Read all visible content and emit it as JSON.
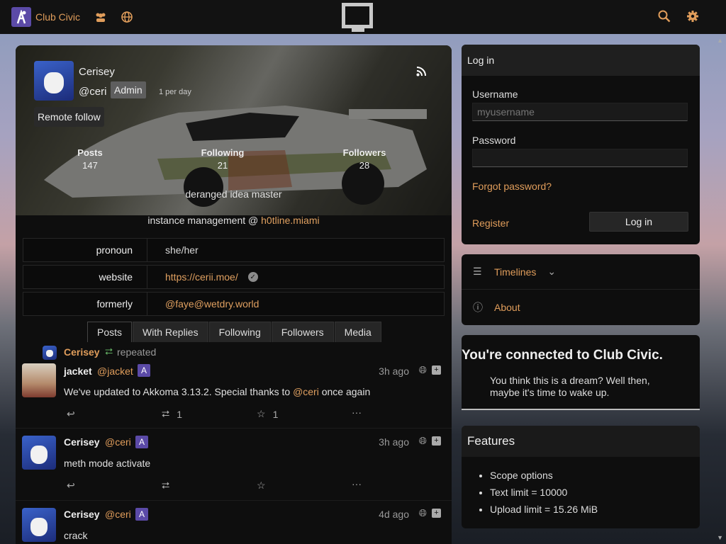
{
  "topbar": {
    "site_name": "Club Civic"
  },
  "profile": {
    "display_name": "Cerisey",
    "handle": "@ceri",
    "badge": "Admin",
    "rate": "1 per day",
    "remote_follow": "Remote follow",
    "stats": [
      {
        "label": "Posts",
        "value": "147"
      },
      {
        "label": "Following",
        "value": "21"
      },
      {
        "label": "Followers",
        "value": "28"
      }
    ],
    "bio_line1": "deranged idea master",
    "bio_line2_prefix": "instance management @ ",
    "bio_line2_link": "h0tline.miami",
    "fields": [
      {
        "name": "pronoun",
        "value": "she/her"
      },
      {
        "name": "website",
        "value": "https://cerii.moe/"
      },
      {
        "name": "formerly",
        "value": "@faye@wetdry.world"
      }
    ],
    "tabs": [
      "Posts",
      "With Replies",
      "Following",
      "Followers",
      "Media"
    ]
  },
  "posts": [
    {
      "repeat_by": "Cerisey",
      "repeat_text": "repeated",
      "name": "jacket",
      "handle": "@jacket",
      "time": "3h ago",
      "text_prefix": "We've updated to Akkoma 3.13.2. Special thanks to ",
      "text_mention": "@ceri",
      "text_suffix": " once again",
      "repeats": "1",
      "favs": "1"
    },
    {
      "name": "Cerisey",
      "handle": "@ceri",
      "time": "3h ago",
      "text": "meth mode activate"
    },
    {
      "name": "Cerisey",
      "handle": "@ceri",
      "time": "4d ago",
      "text": "crack"
    }
  ],
  "login": {
    "title": "Log in",
    "username_label": "Username",
    "username_placeholder": "myusername",
    "password_label": "Password",
    "forgot": "Forgot password?",
    "register": "Register",
    "login_button": "Log in"
  },
  "nav": {
    "timelines": "Timelines",
    "about": "About"
  },
  "connected": {
    "title": "You're connected to Club Civic.",
    "text": "You think this is a dream? Well then, maybe it's time to wake up."
  },
  "features": {
    "title": "Features",
    "items": [
      "Scope options",
      "Text limit = 10000",
      "Upload limit = 15.26 MiB"
    ]
  },
  "colors": {
    "accent": "#e09d5b",
    "brand": "#5b4aa7"
  }
}
